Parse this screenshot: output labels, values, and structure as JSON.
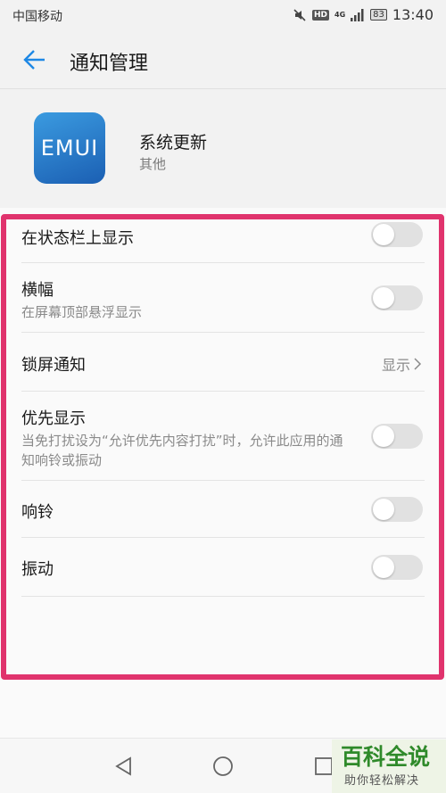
{
  "status_bar": {
    "carrier": "中国移动",
    "hd": "HD",
    "network": "4G",
    "battery": "83",
    "time": "13:40"
  },
  "app_bar": {
    "title": "通知管理",
    "back_icon": "arrow-left-icon"
  },
  "app_header": {
    "logo_text": "EMUI",
    "app_name": "系统更新",
    "category": "其他"
  },
  "settings": {
    "status_bar_display": {
      "label": "在状态栏上显示",
      "enabled": false
    },
    "banner": {
      "label": "横幅",
      "description": "在屏幕顶部悬浮显示",
      "enabled": false
    },
    "lock_screen": {
      "label": "锁屏通知",
      "value": "显示"
    },
    "priority": {
      "label": "优先显示",
      "description": "当免打扰设为“允许优先内容打扰”时，允许此应用的通知响铃或振动",
      "enabled": false
    },
    "ringtone": {
      "label": "响铃",
      "enabled": false
    },
    "vibration": {
      "label": "振动",
      "enabled": false
    }
  },
  "colors": {
    "accent": "#1e88e5",
    "highlight": "#e0336d",
    "toggle_off": "#e1e1e1"
  },
  "watermark": {
    "title": "百科全说",
    "subtitle": "助你轻松解决"
  }
}
